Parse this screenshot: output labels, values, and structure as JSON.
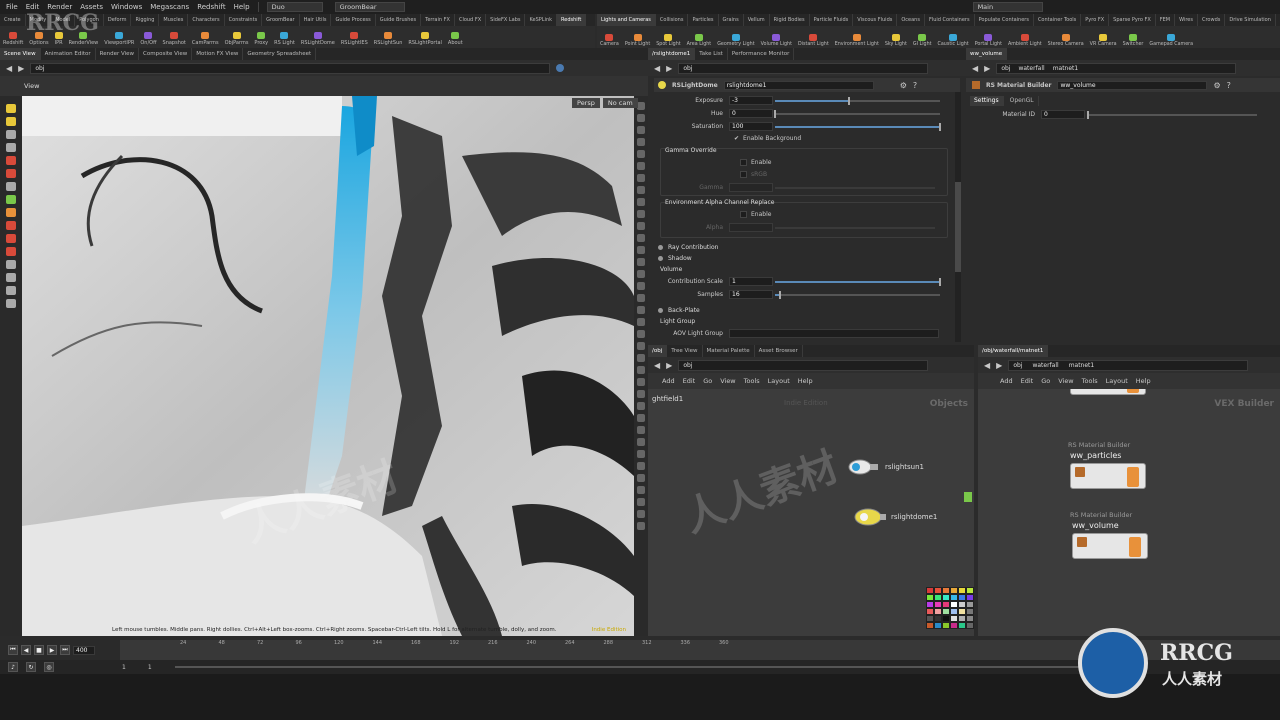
{
  "menubar": {
    "items": [
      "File",
      "Edit",
      "Render",
      "Assets",
      "Windows",
      "Megascans",
      "Redshift",
      "Help"
    ],
    "desktop": "Duo",
    "groom": "GroomBear",
    "main": "Main"
  },
  "shelf_tabs_left": [
    "Create",
    "Modify",
    "Model",
    "Polygon",
    "Deform",
    "Rigging",
    "Muscles",
    "Characters",
    "Constraints",
    "GroomBear",
    "Hair Utils",
    "Guide Process",
    "Guide Brushes",
    "Terrain FX",
    "Cloud FX",
    "SideFX Labs",
    "KeSPLink",
    "Redshift"
  ],
  "shelf_tools_left": [
    "Redshift",
    "Options",
    "IPR",
    "RenderView",
    "ViewportIPR",
    "On/Off",
    "Snapshot",
    "CamParms",
    "ObjParms",
    "Proxy",
    "RS Light",
    "RSLightDome",
    "RSLightIES",
    "RSLightSun",
    "RSLightPortal",
    "About"
  ],
  "shelf_tabs_right": [
    "Lights and Cameras",
    "Collisions",
    "Particles",
    "Grains",
    "Vellum",
    "Rigid Bodies",
    "Particle Fluids",
    "Viscous Fluids",
    "Oceans",
    "Fluid Containers",
    "Populate Containers",
    "Container Tools",
    "Pyro FX",
    "Sparse Pyro FX",
    "FEM",
    "Wires",
    "Crowds",
    "Drive Simulation"
  ],
  "shelf_tools_right": [
    "Camera",
    "Point Light",
    "Spot Light",
    "Area Light",
    "Geometry Light",
    "Volume Light",
    "Distant Light",
    "Environment Light",
    "Sky Light",
    "GI Light",
    "Caustic Light",
    "Portal Light",
    "Ambient Light",
    "Stereo Camera",
    "VR Camera",
    "Switcher",
    "Gamepad Camera"
  ],
  "pane_tabs": [
    "Scene View",
    "Animation Editor",
    "Render View",
    "Composite View",
    "Motion FX View",
    "Geometry Spreadsheet"
  ],
  "viewport": {
    "path": "obj",
    "label": "View",
    "persp": "Persp",
    "cam": "No cam",
    "status": "Left mouse tumbles. Middle pans. Right dollies. Ctrl+Alt+Left box-zooms. Ctrl+Right zooms. Spacebar-Ctrl-Left tilts. Hold L for alternate tumble, dolly, and zoom.",
    "edition": "Indie Edition"
  },
  "param_pane": {
    "tabs": [
      "/rslightdome1",
      "Take List",
      "Performance Monitor"
    ],
    "path": "obj",
    "node_type": "RSLightDome",
    "node_name": "rslightdome1",
    "exposure_label": "Exposure",
    "exposure": "-3",
    "exposure_level": 0.45,
    "hue_label": "Hue",
    "hue": "0",
    "hue_level": 0,
    "saturation_label": "Saturation",
    "saturation": "100",
    "saturation_level": 1.0,
    "enable_background": "Enable Background",
    "gamma_override": "Gamma Override",
    "gamma_enable": "Enable",
    "gamma_srgb": "sRGB",
    "gamma_label": "Gamma",
    "env_alpha": "Environment Alpha Channel Replace",
    "alpha_enable": "Enable",
    "alpha_label": "Alpha",
    "ray_contribution": "Ray Contribution",
    "shadow": "Shadow",
    "volume": "Volume",
    "contribution_scale_label": "Contribution Scale",
    "contribution_scale": "1",
    "contribution_scale_level": 1.0,
    "samples_label": "Samples",
    "samples": "16",
    "samples_level": 0.03,
    "back_plate": "Back-Plate",
    "light_group": "Light Group",
    "aov_light_group": "AOV Light Group"
  },
  "material_pane": {
    "tab": "ww_volume",
    "path_obj": "obj",
    "path_waterfall": "waterfall",
    "path_matnet": "matnet1",
    "node_type": "RS Material Builder",
    "node_name": "ww_volume",
    "tabs": [
      "Settings",
      "OpenGL"
    ],
    "material_id_label": "Material ID",
    "material_id": "0"
  },
  "net_left": {
    "tabs": [
      "/obj",
      "Tree View",
      "Material Palette",
      "Asset Browser"
    ],
    "path": "obj",
    "menu": [
      "Add",
      "Edit",
      "Go",
      "View",
      "Tools",
      "Layout",
      "Help"
    ],
    "context": "Objects",
    "edition": "Indie Edition",
    "partial_node": "ghtfield1",
    "nodes": [
      "rslightsun1",
      "rslightdome1"
    ]
  },
  "net_right": {
    "tab": "/obj/waterfall/matnet1",
    "path_obj": "obj",
    "path_waterfall": "waterfall",
    "path_matnet": "matnet1",
    "menu": [
      "Add",
      "Edit",
      "Go",
      "View",
      "Tools",
      "Layout",
      "Help"
    ],
    "context": "VEX Builder",
    "builder_type_1": "RS Material Builder",
    "builder_name_1": "ww_particles",
    "builder_type_2": "RS Material Builder",
    "builder_name_2": "ww_volume"
  },
  "timeline": {
    "frame": "400",
    "ticks": [
      "24",
      "48",
      "72",
      "96",
      "120",
      "144",
      "168",
      "192",
      "216",
      "240",
      "264",
      "288",
      "312",
      "336",
      "360"
    ],
    "start": "1",
    "start2": "1"
  },
  "watermarks": {
    "brand": "RRCG",
    "cn": "人人素材",
    "logo_cn": "人人素材"
  },
  "colors": {
    "accent_blue": "#1aa6e0",
    "node_orange": "#e8913a",
    "edition_yellow": "#e8d84a"
  }
}
